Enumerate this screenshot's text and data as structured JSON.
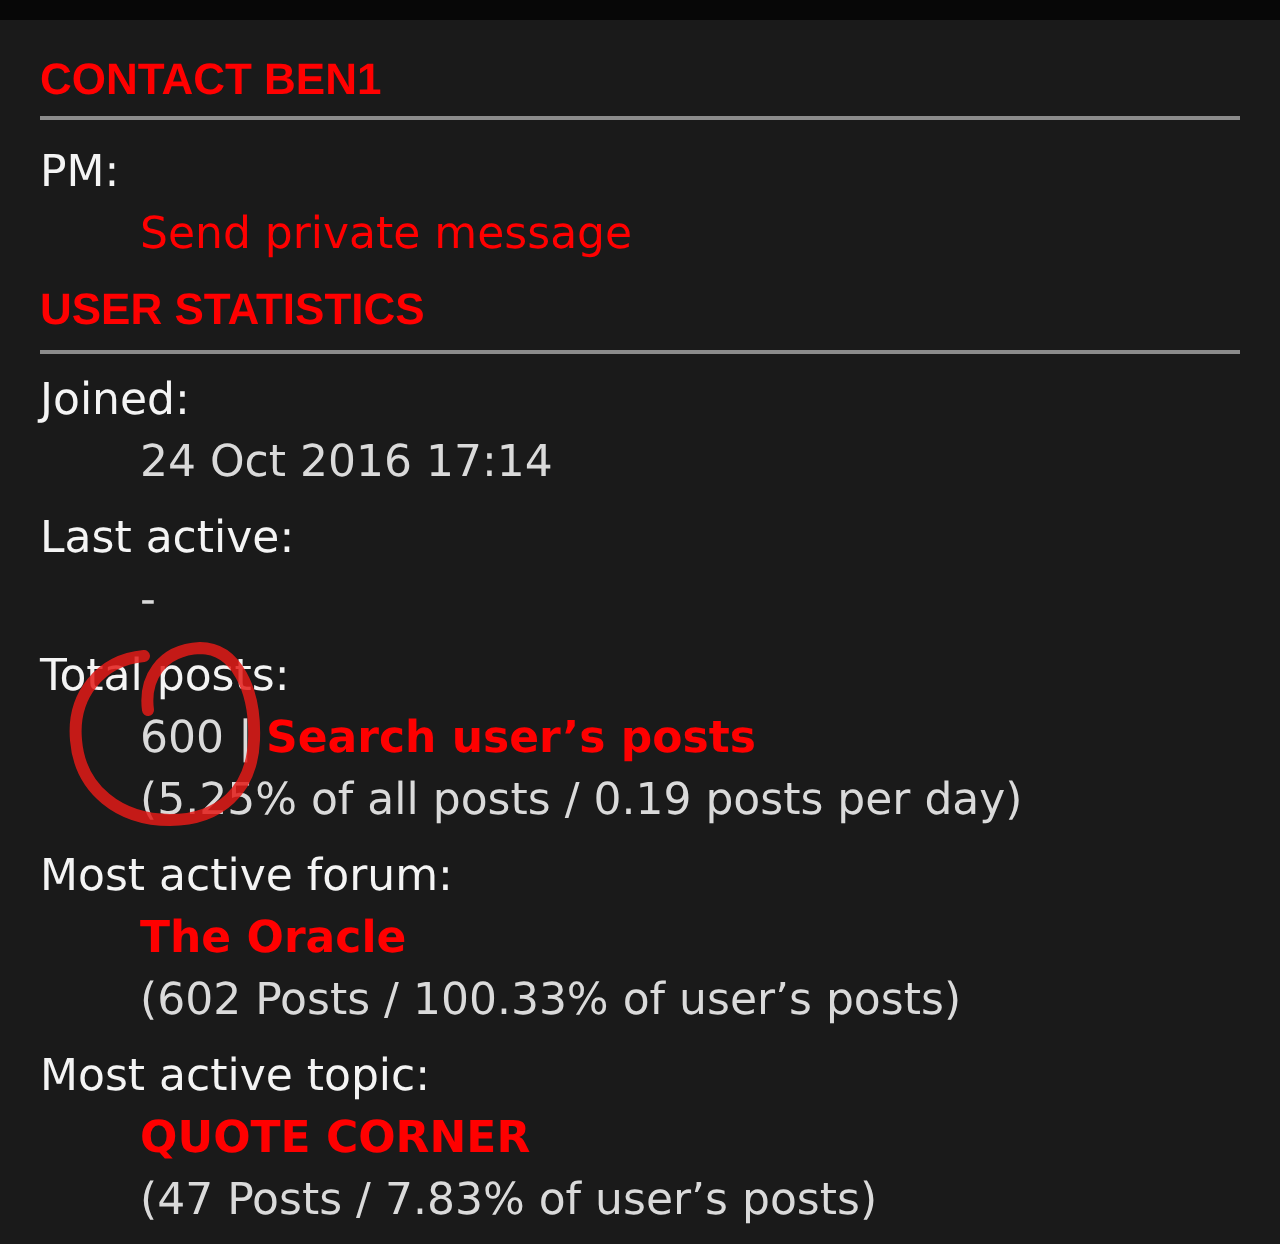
{
  "sections": [
    {
      "heading": "CONTACT BEN1",
      "fields": [
        {
          "label": "PM:",
          "circled": false,
          "lines": [
            [
              {
                "kind": "link",
                "text": "Send private message"
              }
            ]
          ]
        }
      ]
    },
    {
      "heading": "USER STATISTICS",
      "fields": [
        {
          "label": "Joined:",
          "circled": false,
          "lines": [
            [
              {
                "kind": "text",
                "text": "24 Oct 2016 17:14"
              }
            ]
          ]
        },
        {
          "label": "Last active:",
          "circled": false,
          "lines": [
            [
              {
                "kind": "text",
                "text": "-"
              }
            ]
          ]
        },
        {
          "label": "Total posts:",
          "circled": true,
          "lines": [
            [
              {
                "kind": "text",
                "text": "600 |"
              },
              {
                "kind": "bold_link",
                "text": "Search user’s posts"
              }
            ],
            [
              {
                "kind": "text",
                "text": "(5.25% of all posts / 0.19 posts per day)"
              }
            ]
          ]
        },
        {
          "label": "Most active forum:",
          "circled": false,
          "lines": [
            [
              {
                "kind": "bold_link",
                "text": "The Oracle"
              }
            ],
            [
              {
                "kind": "text",
                "text": "(602 Posts / 100.33% of user’s posts)"
              }
            ]
          ]
        },
        {
          "label": "Most active topic:",
          "circled": false,
          "lines": [
            [
              {
                "kind": "bold_link",
                "text": "QUOTE CORNER"
              }
            ],
            [
              {
                "kind": "text",
                "text": "(47 Posts / 7.83% of user’s posts)"
              }
            ]
          ]
        }
      ]
    }
  ]
}
